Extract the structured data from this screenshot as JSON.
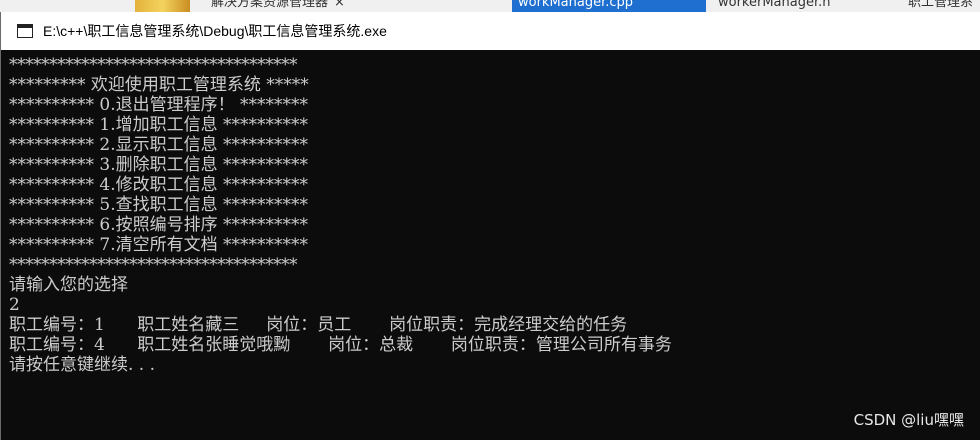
{
  "background": {
    "tabs": [
      {
        "label": "解决方案资源管理器",
        "close": "×",
        "active": false
      },
      {
        "label": "workManager.cpp",
        "close": "",
        "active": true
      },
      {
        "label": "workerManager.h",
        "close": "",
        "active": false
      },
      {
        "label": "职工管理系",
        "close": "",
        "active": false
      }
    ]
  },
  "window": {
    "title": "E:\\c++\\职工信息管理系统\\Debug\\职工信息管理系统.exe",
    "icon": "console-app-icon"
  },
  "console": {
    "lines": [
      "************************************",
      "********* 欢迎使用职工管理系统 *****",
      "********** 0.退出管理程序！ ********",
      "********** 1.增加职工信息 **********",
      "********** 2.显示职工信息 **********",
      "********** 3.删除职工信息 **********",
      "********** 4.修改职工信息 **********",
      "********** 5.查找职工信息 **********",
      "********** 6.按照编号排序 **********",
      "********** 7.清空所有文档 **********",
      "************************************",
      "请输入您的选择",
      "2",
      "职工编号：1      职工姓名藏三     岗位：员工       岗位职责：完成经理交给的任务",
      "职工编号：4      职工姓名张睡觉哦黝       岗位：总裁       岗位职责：管理公司所有事务",
      "请按任意键继续. . ."
    ]
  },
  "watermark": "CSDN @liu嘿嘿"
}
